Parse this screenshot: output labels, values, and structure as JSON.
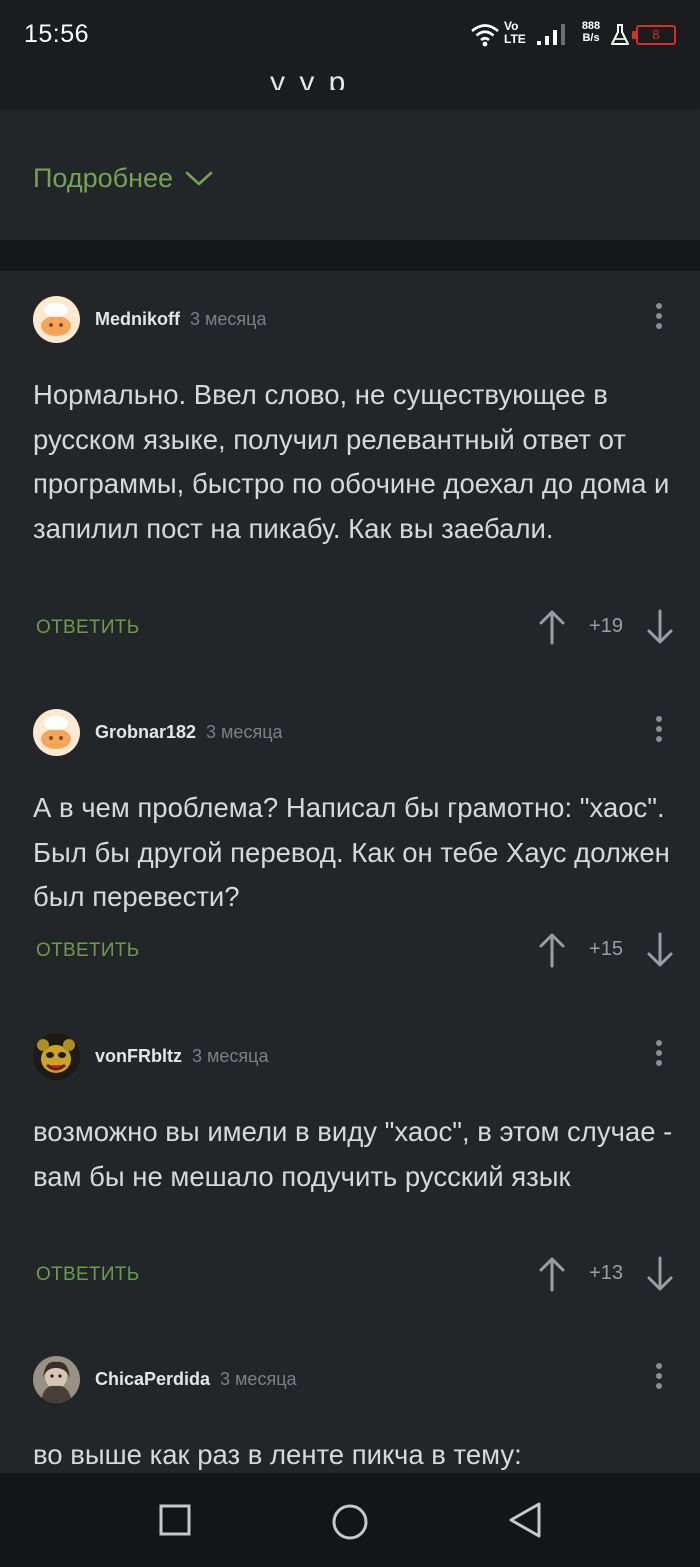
{
  "status_bar": {
    "time": "15:56",
    "volte": [
      "Vo",
      "LTE"
    ],
    "net_speed": [
      "888",
      "B/s"
    ],
    "battery": "8",
    "colors": {
      "battery": "#d32f2f"
    }
  },
  "app_bar": {
    "cut_title": "у у р"
  },
  "post": {
    "more_label": "Подробнее"
  },
  "comments": [
    {
      "author": "Mednikoff",
      "time": "3 месяца",
      "text": "Нормально. Ввел слово, не существующее в русском языке, получил релевантный ответ от программы, быстро по обочине доехал до дома и запилил пост на пикабу. Как вы заебали.",
      "reply_label": "ОТВЕТИТЬ",
      "rating": "+19"
    },
    {
      "author": "Grobnar182",
      "time": "3 месяца",
      "text": "А в чем проблема? Написал бы грамотно: \"хаос\". Был бы другой перевод. Как он тебе Хаус должен был перевести?",
      "reply_label": "ОТВЕТИТЬ",
      "rating": "+15"
    },
    {
      "author": "vonFRbltz",
      "time": "3 месяца",
      "text": "возможно вы имели в виду \"хаос\", в этом случае - вам бы не мешало подучить русский язык",
      "reply_label": "ОТВЕТИТЬ",
      "rating": "+13"
    },
    {
      "author": "ChicaPerdida",
      "time": "3 месяца",
      "text": "во выше как раз в ленте пикча в тему:"
    }
  ],
  "icons": {
    "wifi": "wifi-icon",
    "signal": "signal-icon",
    "flask": "flask-icon",
    "chevron": "chevron-down-icon",
    "kebab": "more-vertical-icon",
    "upvote": "arrow-up-icon",
    "downvote": "arrow-down-icon",
    "nav": [
      "recents-square-icon",
      "home-circle-icon",
      "back-triangle-icon"
    ]
  },
  "colors": {
    "accent": "#76a257",
    "background": "#232628",
    "text": "#d6d8da",
    "muted": "#7b8085"
  }
}
